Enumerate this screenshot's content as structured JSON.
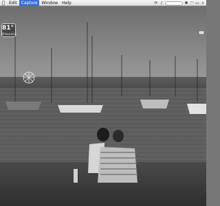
{
  "menubar": {
    "items": [
      "Edit",
      "Capture",
      "Window",
      "Help"
    ],
    "active_index": 1,
    "search_placeholder": "Google"
  },
  "weather": {
    "temperature": "81°",
    "city": "Milwaukee"
  }
}
